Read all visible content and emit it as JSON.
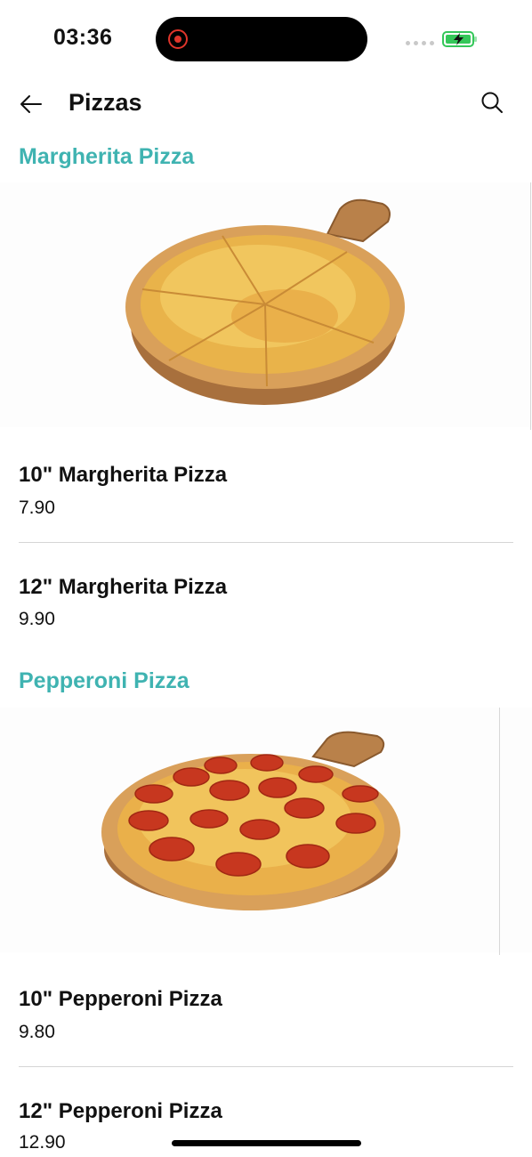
{
  "status": {
    "time": "03:36"
  },
  "header": {
    "title": "Pizzas"
  },
  "sections": [
    {
      "title": "Margherita Pizza",
      "image": "margherita-pizza-on-board",
      "items": [
        {
          "name": "10\" Margherita Pizza",
          "price": "7.90"
        },
        {
          "name": "12\" Margherita Pizza",
          "price": "9.90"
        }
      ]
    },
    {
      "title": "Pepperoni Pizza",
      "image": "pepperoni-pizza-on-board",
      "items": [
        {
          "name": "10\" Pepperoni Pizza",
          "price": "9.80"
        },
        {
          "name": "12\" Pepperoni Pizza",
          "price": "12.90"
        }
      ]
    }
  ],
  "colors": {
    "section_title": "#3fb3b1",
    "record": "#e0352b",
    "battery": "#34c759"
  }
}
